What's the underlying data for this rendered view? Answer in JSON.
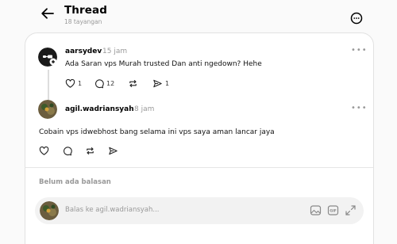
{
  "header": {
    "title": "Thread",
    "views": "18 tayangan"
  },
  "post": {
    "username": "aarsydev",
    "time": "15 jam",
    "text": "Ada Saran vps Murah trusted Dan anti ngedown? Hehe",
    "like_count": "1",
    "comment_count": "12",
    "repost_count": "",
    "share_count": "1"
  },
  "reply": {
    "username": "agil.wadriansyah",
    "time": "8 jam",
    "text": "Cobain vps idwebhost bang selama ini vps saya aman lancar jaya"
  },
  "footer": {
    "no_replies": "Belum ada balasan",
    "reply_placeholder": "Balas ke agil.wadriansyah..."
  },
  "colors": {
    "background": "#fafafa",
    "card": "#ffffff",
    "muted": "#999999",
    "input_bg": "#f2f2f2"
  },
  "icons": {
    "back": "arrow-left-icon",
    "more": "more-circle-icon",
    "like": "heart-icon",
    "comment": "comment-bubble-icon",
    "repost": "repost-icon",
    "share": "send-icon",
    "image": "image-icon",
    "gif": "gif-icon",
    "expand": "expand-icon"
  }
}
